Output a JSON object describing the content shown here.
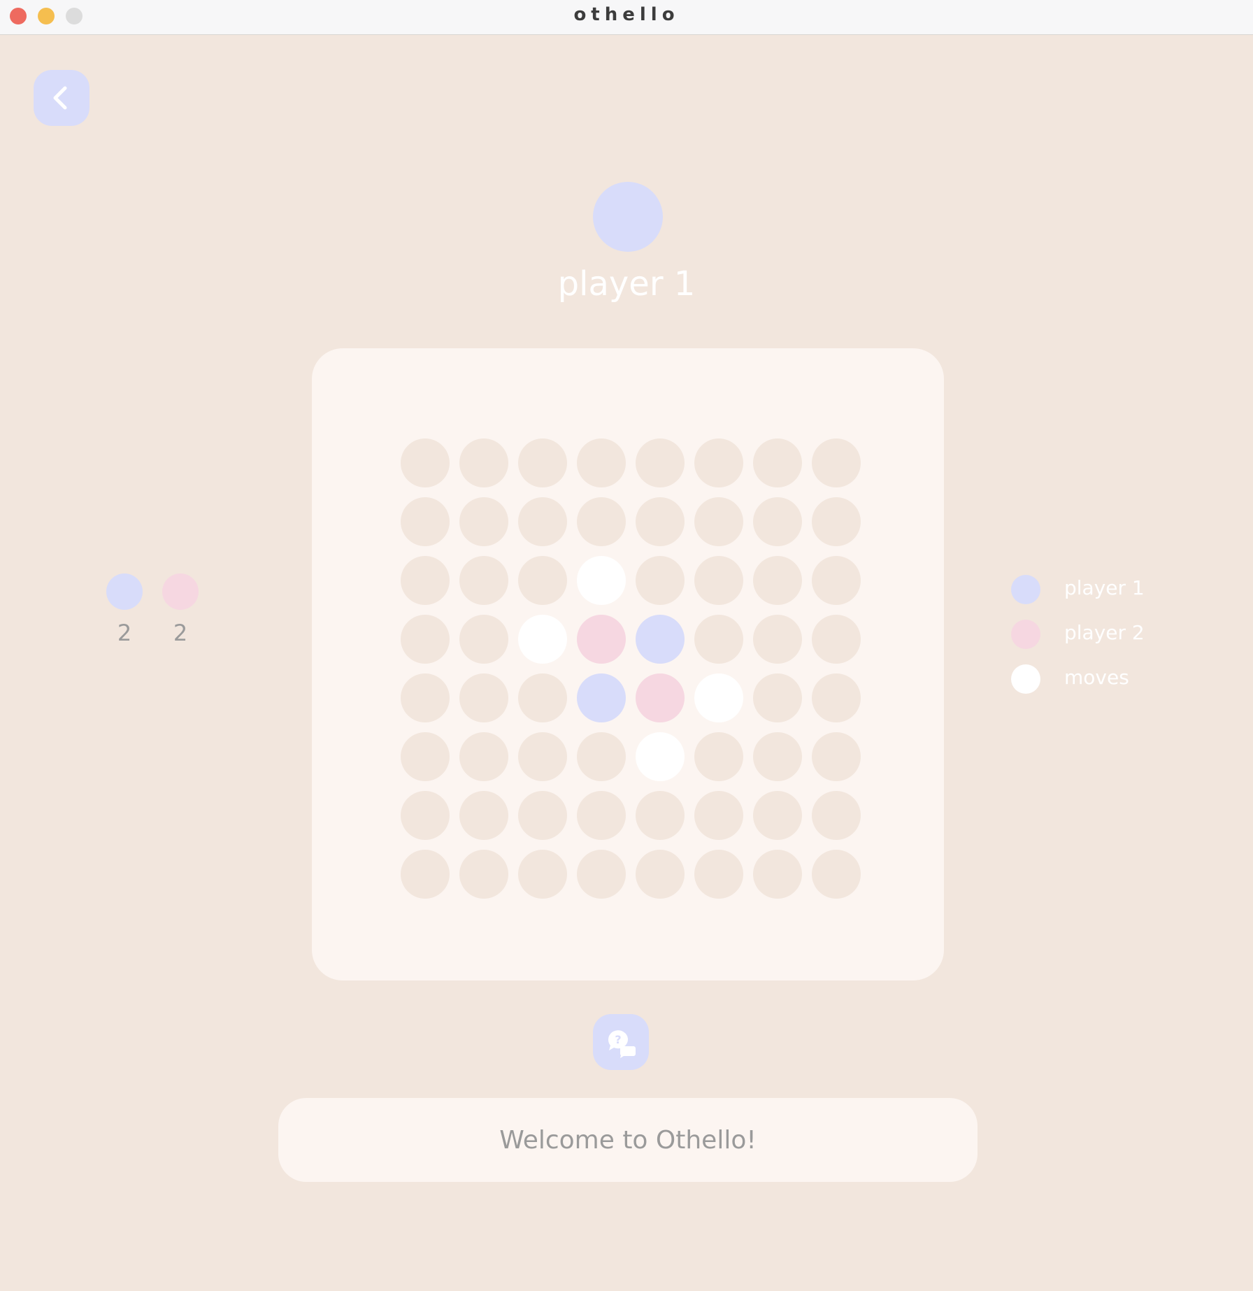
{
  "window": {
    "title": "othello"
  },
  "colors": {
    "background": "#f2e6dd",
    "panel": "#fcf5f1",
    "player1": "#d8dcfa",
    "player2": "#f6d7e1",
    "move": "#ffffff",
    "empty": "#f2e6dd"
  },
  "header": {
    "back_icon": "chevron-left-icon",
    "current_player_label": "player 1",
    "current_player": "player1"
  },
  "scores": {
    "player1": "2",
    "player2": "2"
  },
  "board": {
    "rows": [
      [
        "empty",
        "empty",
        "empty",
        "empty",
        "empty",
        "empty",
        "empty",
        "empty"
      ],
      [
        "empty",
        "empty",
        "empty",
        "empty",
        "empty",
        "empty",
        "empty",
        "empty"
      ],
      [
        "empty",
        "empty",
        "empty",
        "move",
        "empty",
        "empty",
        "empty",
        "empty"
      ],
      [
        "empty",
        "empty",
        "move",
        "player2",
        "player1",
        "empty",
        "empty",
        "empty"
      ],
      [
        "empty",
        "empty",
        "empty",
        "player1",
        "player2",
        "move",
        "empty",
        "empty"
      ],
      [
        "empty",
        "empty",
        "empty",
        "empty",
        "move",
        "empty",
        "empty",
        "empty"
      ],
      [
        "empty",
        "empty",
        "empty",
        "empty",
        "empty",
        "empty",
        "empty",
        "empty"
      ],
      [
        "empty",
        "empty",
        "empty",
        "empty",
        "empty",
        "empty",
        "empty",
        "empty"
      ]
    ]
  },
  "legend": {
    "items": [
      {
        "label": "player 1",
        "kind": "player1"
      },
      {
        "label": "player 2",
        "kind": "player2"
      },
      {
        "label": "moves",
        "kind": "move"
      }
    ]
  },
  "help": {
    "icon": "help-chat-icon"
  },
  "message": {
    "text": "Welcome to Othello!"
  }
}
